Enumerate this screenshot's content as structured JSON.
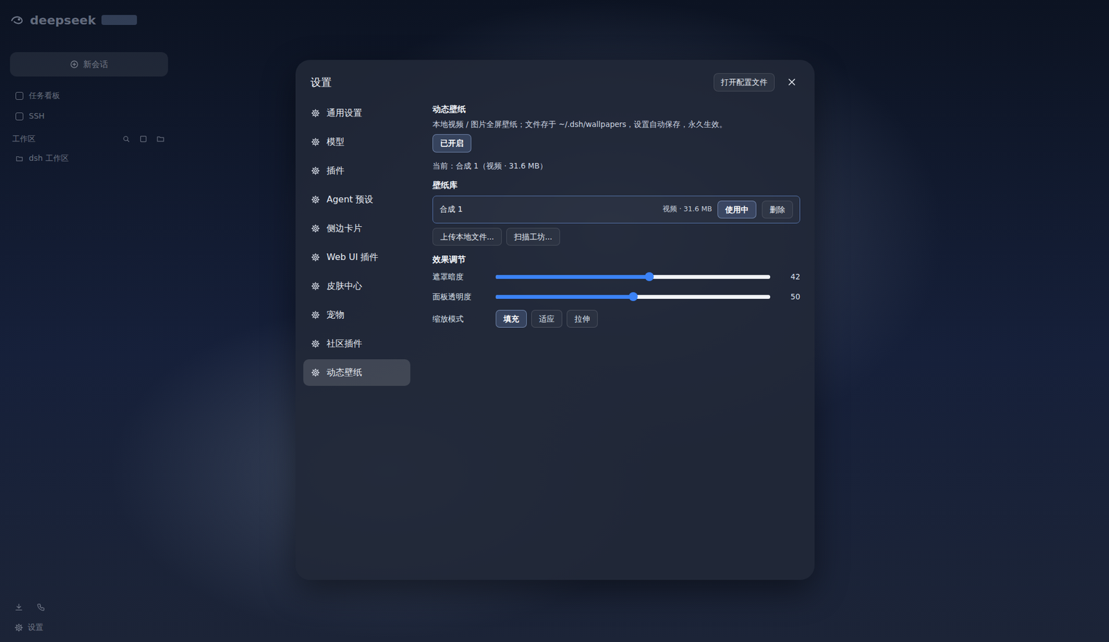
{
  "app": {
    "logo": "deepseek",
    "new_chat": "新会话",
    "nav": [
      {
        "label": "任务看板"
      },
      {
        "label": "SSH"
      }
    ],
    "workspace_header": "工作区",
    "workspaces": [
      {
        "label": "dsh 工作区"
      }
    ],
    "settings": "设置"
  },
  "modal": {
    "title": "设置",
    "open_config": "打开配置文件",
    "nav": [
      {
        "label": "通用设置",
        "selected": false
      },
      {
        "label": "模型",
        "selected": false
      },
      {
        "label": "插件",
        "selected": false
      },
      {
        "label": "Agent 预设",
        "selected": false
      },
      {
        "label": "侧边卡片",
        "selected": false
      },
      {
        "label": "Web UI 插件",
        "selected": false
      },
      {
        "label": "皮肤中心",
        "selected": false
      },
      {
        "label": "宠物",
        "selected": false
      },
      {
        "label": "社区插件",
        "selected": false
      },
      {
        "label": "动态壁纸",
        "selected": true
      }
    ],
    "section": {
      "title": "动态壁纸",
      "description": "本地视频 / 图片全屏壁纸；文件存于 ~/.dsh/wallpapers，设置自动保存，永久生效。",
      "toggle": {
        "label": "已开启",
        "on": true
      },
      "current": "当前：合成 1（视频 · 31.6 MB）",
      "library_title": "壁纸库",
      "library": [
        {
          "name": "合成 1",
          "meta": "视频 · 31.6 MB",
          "use_label": "使用中",
          "selected": true,
          "delete_label": "删除"
        }
      ],
      "actions": [
        "上传本地文件...",
        "扫描工坊..."
      ],
      "effects_title": "效果调节",
      "sliders": [
        {
          "label": "遮罩暗度",
          "level": 0.56,
          "reading": "42"
        },
        {
          "label": "面板透明度",
          "level": 0.5,
          "reading": "50"
        }
      ],
      "scale": {
        "label": "缩放模式",
        "options": [
          {
            "label": "填充",
            "selected": true
          },
          {
            "label": "适应",
            "selected": false
          },
          {
            "label": "拉伸",
            "selected": false
          }
        ]
      }
    }
  }
}
